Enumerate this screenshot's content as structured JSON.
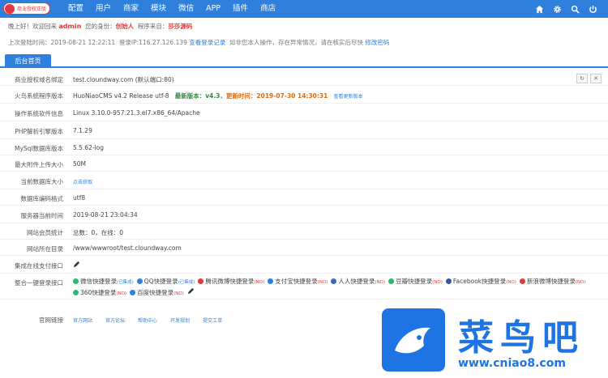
{
  "logo": {
    "text": "商业授权正版"
  },
  "nav": [
    "配置",
    "用户",
    "商家",
    "模块",
    "微信",
    "APP",
    "插件",
    "商店"
  ],
  "tools": [
    "home-icon",
    "gear-icon",
    "search-icon",
    "power-icon"
  ],
  "welcome": {
    "prefix": "晚上好！欢迎回来",
    "user": "admin",
    "role_label": "您的身份：",
    "role": "创始人",
    "source_label": "程序来自：",
    "source": "莎莎源码"
  },
  "lastlogin": {
    "label": "上次登陆时间：",
    "time": "2019-08-21 12:22:11",
    "ip": "登录IP:116.27.126.139",
    "record_link": "查看登录记录",
    "notice": "如非您本人操作，存在异常情况，请在核实后尽快",
    "change_pwd": "修改密码"
  },
  "tab": "后台首页",
  "rows": {
    "domain": {
      "label": "商业授权域名绑定",
      "value": "test.cloundway.com (默认端口:80)"
    },
    "version": {
      "label": "火鸟系统程序版本",
      "value": "HuoNiaoCMS v4.2 Release utf-8",
      "latest_label": "最新版本：",
      "latest": "v4.3",
      "update_label": "更新时间：",
      "update": "2019-07-30 14:30:31",
      "update_link": "查看更新版本"
    },
    "os": {
      "label": "操作系统软件信息",
      "value": "Linux 3.10.0-957.21.3.el7.x86_64/Apache"
    },
    "php": {
      "label": "PHP解析引擎版本",
      "value": "7.1.29"
    },
    "mysql": {
      "label": "MySql数据库版本",
      "value": "5.5.62-log"
    },
    "upload": {
      "label": "最大附件上传大小",
      "value": "50M"
    },
    "dbsize": {
      "label": "当前数据库大小",
      "value": "点击获取"
    },
    "charset": {
      "label": "数据库编码格式",
      "value": "utf8"
    },
    "server_time": {
      "label": "服务器当前时间",
      "value": "2019-08-21 23:04:34"
    },
    "members": {
      "label": "网站会员统计",
      "value": "总数：0，在线：0"
    },
    "dir": {
      "label": "网站所在目录",
      "value": "/www/wwwroot/test.cloundway.com"
    },
    "pay": {
      "label": "集成在线支付接口"
    },
    "login": {
      "label": "整合一键登录接口"
    },
    "official": {
      "label": "官网链接"
    }
  },
  "login_items": [
    {
      "name": "微信快捷登录",
      "tag": "(已集成)",
      "color": "#2eb872",
      "tag_blue": true
    },
    {
      "name": "QQ快捷登录",
      "tag": "(已集成)",
      "color": "#2f7fdc",
      "tag_blue": true
    },
    {
      "name": "腾讯微博快捷登录",
      "tag": "(NO)",
      "color": "#e4393c",
      "tag_blue": false
    },
    {
      "name": "支付宝快捷登录",
      "tag": "(NO)",
      "color": "#2f7fdc",
      "tag_blue": false
    },
    {
      "name": "人人快捷登录",
      "tag": "(NO)",
      "color": "#3b6ab5",
      "tag_blue": false
    },
    {
      "name": "豆瓣快捷登录",
      "tag": "(NO)",
      "color": "#2eb872",
      "tag_blue": false
    },
    {
      "name": "Facebook快捷登录",
      "tag": "(NO)",
      "color": "#3b5998",
      "tag_blue": false
    },
    {
      "name": "新浪微博快捷登录",
      "tag": "(NO)",
      "color": "#e4393c",
      "tag_blue": false
    },
    {
      "name": "360快捷登录",
      "tag": "(NO)",
      "color": "#2eb872",
      "tag_blue": false
    },
    {
      "name": "百度快捷登录",
      "tag": "(NO)",
      "color": "#2f7fdc",
      "tag_blue": false
    }
  ],
  "official_links": [
    "官方网站",
    "官方论坛",
    "帮助中心",
    "开发规划",
    "提交工单"
  ],
  "watermark": {
    "cn": "菜鸟吧",
    "url": "www.cniao8.com"
  }
}
